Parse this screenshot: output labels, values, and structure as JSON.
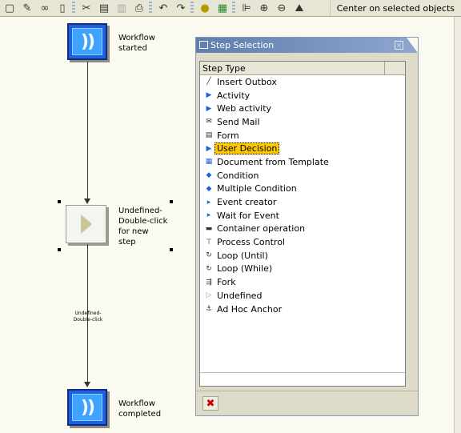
{
  "toolbar": {
    "icons": [
      "new-icon",
      "pencil-icon",
      "glasses-icon",
      "trash-icon",
      "scissors-icon",
      "copy-icon",
      "paste-icon",
      "print-icon",
      "undo-icon",
      "redo-icon",
      "graph-icon",
      "tree-icon",
      "align-left-icon",
      "zoom-in-icon",
      "zoom-out-icon",
      "overview-icon"
    ],
    "center_label": "Center on selected objects"
  },
  "canvas": {
    "start_node": {
      "glyph": "))",
      "label_line1": "Workflow",
      "label_line2": "started"
    },
    "undefined_node": {
      "label_line1": "Undefined-",
      "label_line2": "Double-click",
      "label_line3": "for new",
      "label_line4": "step"
    },
    "branch_label_line1": "Undefined-",
    "branch_label_line2": "Double-click",
    "end_node": {
      "glyph": "))",
      "label_line1": "Workflow",
      "label_line2": "completed"
    }
  },
  "dialog": {
    "title": "Step Selection",
    "close_glyph": "×",
    "column_header": "Step Type",
    "items": [
      {
        "label": "Insert Outbox",
        "icon": "slash-icon",
        "glyph": "╱"
      },
      {
        "label": "Activity",
        "icon": "activity-icon",
        "glyph": "▶"
      },
      {
        "label": "Web activity",
        "icon": "web-activity-icon",
        "glyph": "▶"
      },
      {
        "label": "Send Mail",
        "icon": "send-mail-icon",
        "glyph": "✉"
      },
      {
        "label": "Form",
        "icon": "form-icon",
        "glyph": "▤"
      },
      {
        "label": "User Decision",
        "icon": "user-decision-icon",
        "glyph": "▶",
        "selected": true
      },
      {
        "label": "Document from Template",
        "icon": "document-template-icon",
        "glyph": "▦"
      },
      {
        "label": "Condition",
        "icon": "condition-icon",
        "glyph": "◆"
      },
      {
        "label": "Multiple Condition",
        "icon": "multiple-condition-icon",
        "glyph": "◆"
      },
      {
        "label": "Event creator",
        "icon": "event-creator-icon",
        "glyph": "▸"
      },
      {
        "label": "Wait for Event",
        "icon": "wait-event-icon",
        "glyph": "▸"
      },
      {
        "label": "Container operation",
        "icon": "container-operation-icon",
        "glyph": "▬"
      },
      {
        "label": "Process Control",
        "icon": "process-control-icon",
        "glyph": "⊤"
      },
      {
        "label": "Loop (Until)",
        "icon": "loop-until-icon",
        "glyph": "↻"
      },
      {
        "label": "Loop (While)",
        "icon": "loop-while-icon",
        "glyph": "↻"
      },
      {
        "label": "Fork",
        "icon": "fork-icon",
        "glyph": "⇶"
      },
      {
        "label": "Undefined",
        "icon": "undefined-icon",
        "glyph": "▷"
      },
      {
        "label": "Ad Hoc Anchor",
        "icon": "anchor-icon",
        "glyph": "⚓"
      }
    ],
    "cancel_glyph": "✖"
  },
  "colors": {
    "background": "#fbfaf1",
    "node_blue": "#1f5fe0",
    "selection": "#fdc800",
    "title_bar": "#5f7dae"
  }
}
